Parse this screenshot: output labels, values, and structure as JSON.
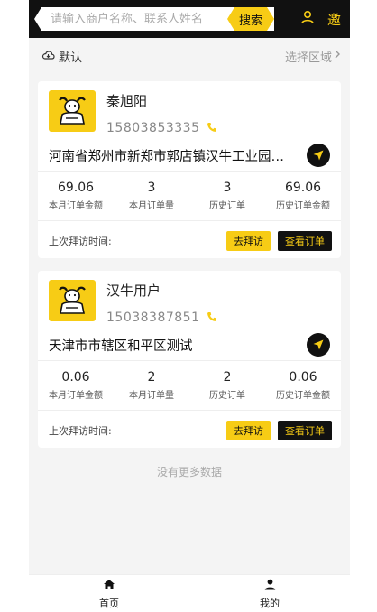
{
  "search": {
    "placeholder": "请输入商户名称、联系人姓名",
    "button_label": "搜索"
  },
  "header": {
    "invite_label": "邀"
  },
  "region": {
    "default_label": "默认",
    "select_label": "选择区域"
  },
  "merchants": [
    {
      "name": "秦旭阳",
      "phone": "15803853335",
      "address": "河南省郑州市新郑市郭店镇汉牛工业园区测试地址",
      "stats": [
        {
          "value": "69.06",
          "label": "本月订单金额"
        },
        {
          "value": "3",
          "label": "本月订单量"
        },
        {
          "value": "3",
          "label": "历史订单"
        },
        {
          "value": "69.06",
          "label": "历史订单金额"
        }
      ],
      "last_visit_label": "上次拜访时间:",
      "visit_button": "去拜访",
      "order_button": "查看订单"
    },
    {
      "name": "汉牛用户",
      "phone": "15038387851",
      "address": "天津市市辖区和平区测试",
      "stats": [
        {
          "value": "0.06",
          "label": "本月订单金额"
        },
        {
          "value": "2",
          "label": "本月订单量"
        },
        {
          "value": "2",
          "label": "历史订单"
        },
        {
          "value": "0.06",
          "label": "历史订单金额"
        }
      ],
      "last_visit_label": "上次拜访时间:",
      "visit_button": "去拜访",
      "order_button": "查看订单"
    }
  ],
  "list": {
    "no_more_text": "没有更多数据"
  },
  "tabbar": {
    "items": [
      {
        "label": "首页",
        "icon": "home-icon"
      },
      {
        "label": "我的",
        "icon": "user-icon"
      }
    ]
  },
  "colors": {
    "accent": "#f7cc15",
    "dark": "#111111",
    "background": "#f4f4f4"
  }
}
